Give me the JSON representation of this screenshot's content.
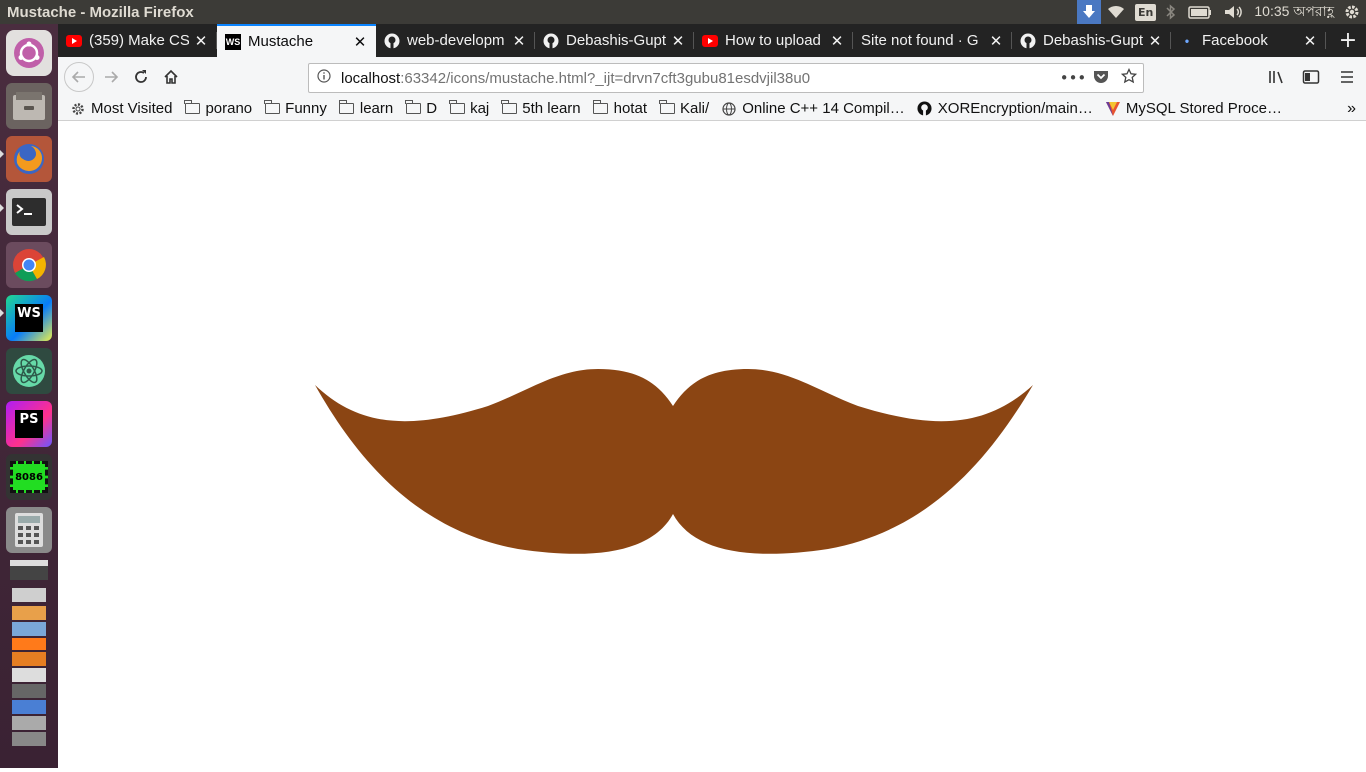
{
  "window": {
    "title": "Mustache - Mozilla Firefox"
  },
  "tray": {
    "lang": "En",
    "clock": "10:35 অপরাহ্ণ",
    "icons": [
      "download-icon",
      "wifi-icon",
      "bluetooth-icon",
      "battery-icon",
      "volume-icon",
      "settings-icon"
    ]
  },
  "launcher": {
    "items": [
      {
        "name": "ubuntu-icon"
      },
      {
        "name": "files-icon"
      },
      {
        "name": "firefox-icon"
      },
      {
        "name": "terminal-icon"
      },
      {
        "name": "chrome-icon"
      },
      {
        "name": "webstorm-icon",
        "label": "WS"
      },
      {
        "name": "atom-icon"
      },
      {
        "name": "phpstorm-icon",
        "label": "PS"
      },
      {
        "name": "emu8086-icon",
        "label": "8086"
      },
      {
        "name": "calculator-icon"
      },
      {
        "name": "video-icon"
      }
    ]
  },
  "tabs": [
    {
      "label": "(359) Make CSS",
      "icon": "youtube-icon"
    },
    {
      "label": "Mustache",
      "icon": "webstorm-icon",
      "active": true
    },
    {
      "label": "web-developm",
      "icon": "github-icon"
    },
    {
      "label": "Debashis-Gupt",
      "icon": "github-icon"
    },
    {
      "label": "How to upload",
      "icon": "youtube-icon"
    },
    {
      "label": "Site not found · G",
      "icon": "none"
    },
    {
      "label": "Debashis-Gupt",
      "icon": "github-icon"
    },
    {
      "label": "Facebook",
      "icon": "dot-icon"
    }
  ],
  "urlbar": {
    "host": "localhost",
    "rest": ":63342/icons/mustache.html?_ijt=drvn7cft3gubu81esdvjil38u0"
  },
  "bookmarks": [
    {
      "label": "Most Visited",
      "icon": "gear-icon"
    },
    {
      "label": "porano",
      "icon": "folder-icon"
    },
    {
      "label": "Funny",
      "icon": "folder-icon"
    },
    {
      "label": "learn",
      "icon": "folder-icon"
    },
    {
      "label": "D",
      "icon": "folder-icon"
    },
    {
      "label": "kaj",
      "icon": "folder-icon"
    },
    {
      "label": "5th learn",
      "icon": "folder-icon"
    },
    {
      "label": "hotat",
      "icon": "folder-icon"
    },
    {
      "label": "Kali/",
      "icon": "folder-icon"
    },
    {
      "label": "Online C++ 14 Compil…",
      "icon": "globe-icon"
    },
    {
      "label": "XOREncryption/main…",
      "icon": "github-icon"
    },
    {
      "label": "MySQL Stored Proce…",
      "icon": "mysql-icon"
    }
  ],
  "page": {
    "mustache_color": "#8b4513"
  }
}
